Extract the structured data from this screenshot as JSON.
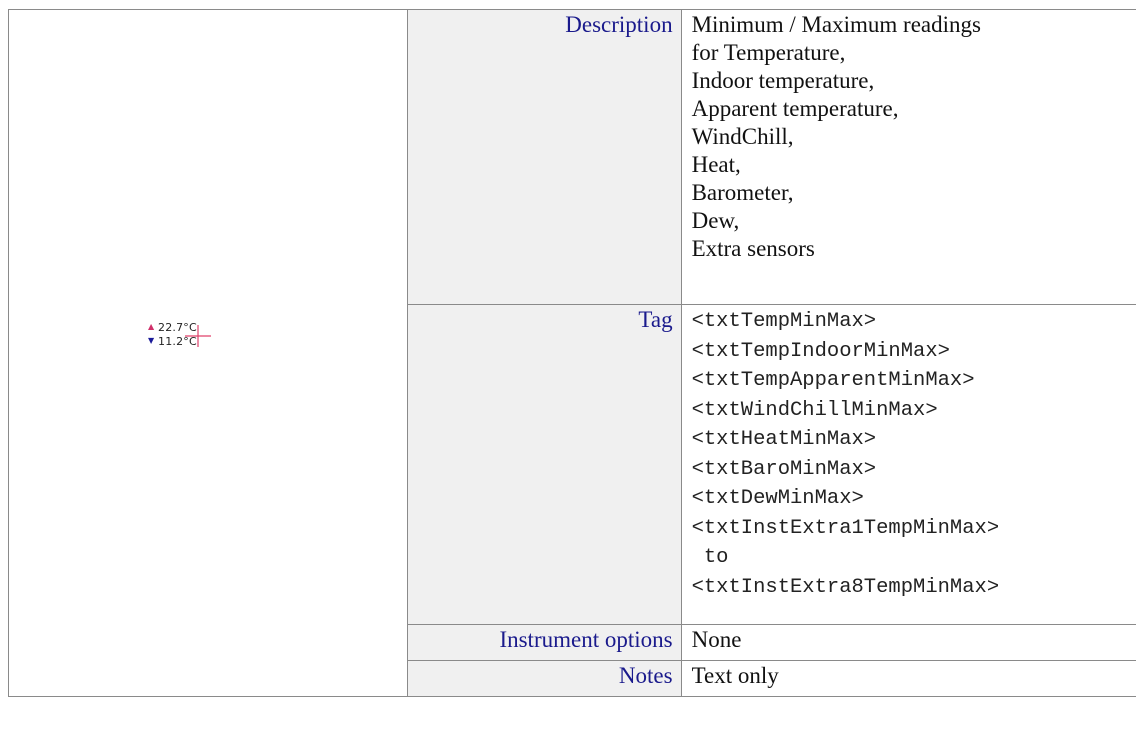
{
  "preview": {
    "max_arrow": "▲",
    "max_value": "22.7°C",
    "min_arrow": "▼",
    "min_value": "11.2°C",
    "max_arrow_color": "#d0306a",
    "min_arrow_color": "#1a1a9a",
    "crosshair_color": "#e0406a"
  },
  "rows": {
    "description": {
      "label": "Description",
      "lines": [
        "Minimum / Maximum readings",
        "for Temperature,",
        "Indoor temperature,",
        "Apparent temperature,",
        "WindChill,",
        "Heat,",
        "Barometer,",
        "Dew,",
        "Extra sensors"
      ]
    },
    "tag": {
      "label": "Tag",
      "lines": [
        "<txtTempMinMax>",
        "<txtTempIndoorMinMax>",
        "<txtTempApparentMinMax>",
        "<txtWindChillMinMax>",
        "<txtHeatMinMax>",
        "<txtBaroMinMax>",
        "<txtDewMinMax>",
        "<txtInstExtra1TempMinMax>",
        " to",
        "<txtInstExtra8TempMinMax>"
      ]
    },
    "instrument_options": {
      "label": "Instrument options",
      "value": "None"
    },
    "notes": {
      "label": "Notes",
      "value": "Text only"
    }
  },
  "colors": {
    "label_text": "#1a1a8c",
    "label_background": "#f0f0f0",
    "border": "#8a8a8a"
  }
}
